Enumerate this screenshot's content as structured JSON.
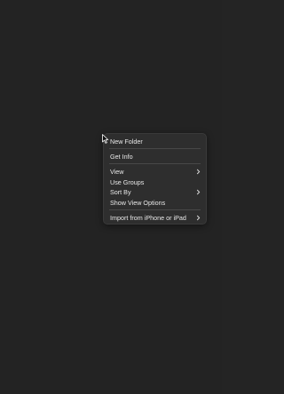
{
  "context_menu": {
    "items": [
      {
        "label": "New Folder"
      },
      {
        "label": "Get Info"
      },
      {
        "label": "View",
        "submenu": true
      },
      {
        "label": "Use Groups"
      },
      {
        "label": "Sort By",
        "submenu": true
      },
      {
        "label": "Show View Options"
      },
      {
        "label": "Import from iPhone or iPad",
        "submenu": true
      }
    ]
  },
  "icons": {
    "cursor": "arrow-cursor-icon",
    "submenu": "chevron-right-icon"
  },
  "colors": {
    "desktop_background": "#232323",
    "menu_background": "#2e2e2e",
    "menu_text": "#e8e8e8",
    "separator": "#484848"
  }
}
